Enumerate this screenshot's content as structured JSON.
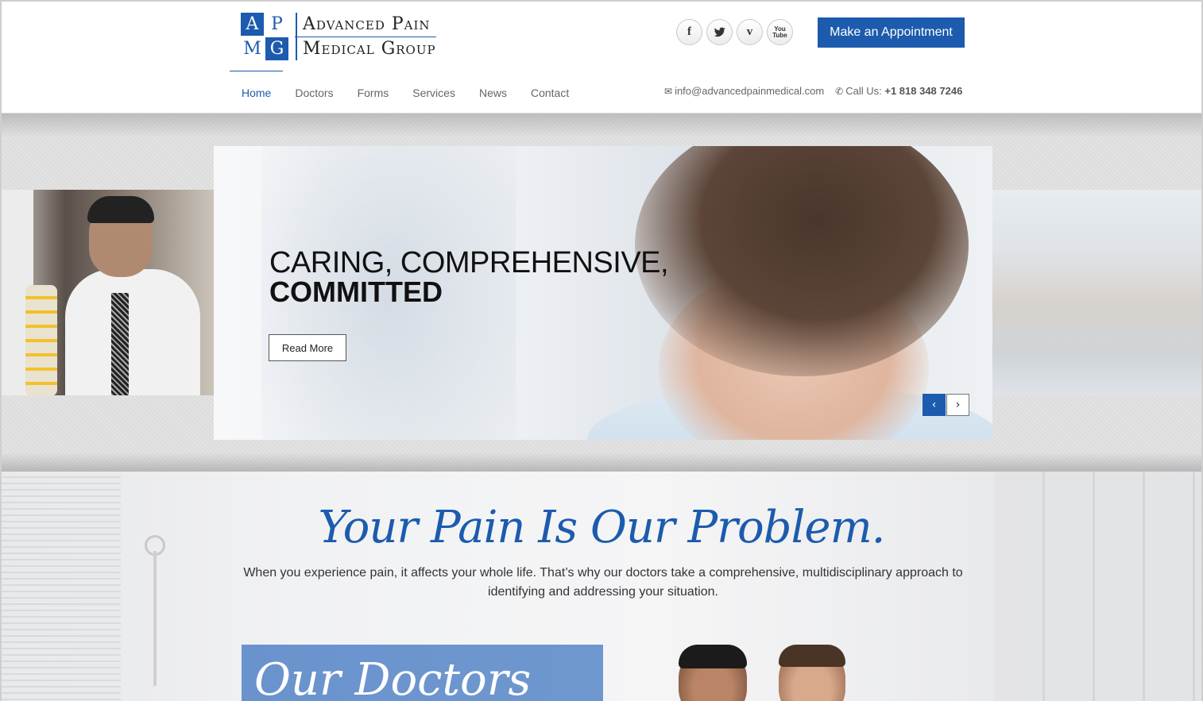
{
  "brand": {
    "logo_letters": [
      "A",
      "P",
      "M",
      "G"
    ],
    "name_line1": "Advanced Pain",
    "name_line2": "Medical Group",
    "primary_color": "#1c5bad"
  },
  "header": {
    "socials": [
      {
        "icon": "facebook-icon",
        "glyph": "f"
      },
      {
        "icon": "twitter-icon",
        "glyph": "🐦"
      },
      {
        "icon": "vimeo-icon",
        "glyph": "v"
      },
      {
        "icon": "youtube-icon",
        "glyph": "You Tube"
      }
    ],
    "appointment_label": "Make an Appointment",
    "nav": [
      {
        "label": "Home",
        "active": true
      },
      {
        "label": "Doctors",
        "active": false
      },
      {
        "label": "Forms",
        "active": false
      },
      {
        "label": "Services",
        "active": false
      },
      {
        "label": "News",
        "active": false
      },
      {
        "label": "Contact",
        "active": false
      }
    ],
    "email": "info@advancedpainmedical.com",
    "call_prefix": "Call Us:",
    "phone": "+1 818 348 7246"
  },
  "slider": {
    "headline_line1": "CARING, COMPREHENSIVE,",
    "headline_line2": "COMMITTED",
    "cta_label": "Read More",
    "prev_glyph": "‹",
    "next_glyph": "›"
  },
  "intro": {
    "tagline": "Your Pain Is Our Problem.",
    "body": "When you experience pain, it affects your whole life. That’s why our doctors take a comprehensive, multidisciplinary approach to identifying and addressing your situation."
  },
  "doctors": {
    "title": "Our Doctors"
  }
}
